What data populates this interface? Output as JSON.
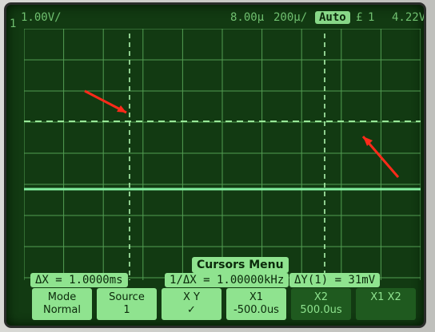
{
  "status": {
    "channel": "1",
    "volts_per_div": "1.00V/",
    "trigger_pos": "8.00µ",
    "time_per_div": "200µ/",
    "auto": "Auto",
    "trigger_slope": "£",
    "trigger_channel": "1",
    "trigger_level": "4.22V"
  },
  "menu_title": "Cursors Menu",
  "readouts": {
    "delta_x": "ΔX = 1.0000ms",
    "inv_delta_x": "1/ΔX = 1.00000kHz",
    "delta_y": "ΔY(1) = 31mV"
  },
  "softkeys": [
    {
      "l1": "Mode",
      "l2": "Normal"
    },
    {
      "l1": "Source",
      "l2": "1"
    },
    {
      "l1": "X      Y",
      "l2": "✓"
    },
    {
      "l1": "X1",
      "l2": "-500.0us"
    },
    {
      "l1": "X2",
      "l2": "500.0us"
    },
    {
      "l1": "X1  X2",
      "l2": ""
    }
  ],
  "colors": {
    "screen_bg": "#123a12",
    "trace": "#84f0a0",
    "grid": "#5aa85a",
    "softkey": "#8fe38f",
    "arrow": "#ff2a1a"
  }
}
